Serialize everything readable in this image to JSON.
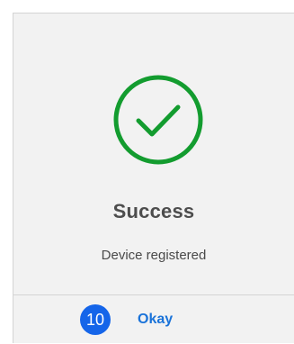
{
  "dialog": {
    "icon": "checkmark-circle-icon",
    "title": "Success",
    "message": "Device registered",
    "badge": "10",
    "button_label": "Okay"
  },
  "colors": {
    "accent_green": "#139c2f",
    "badge_blue": "#1565e9",
    "link_blue": "#1a73d9",
    "background": "#f2f2f2"
  }
}
